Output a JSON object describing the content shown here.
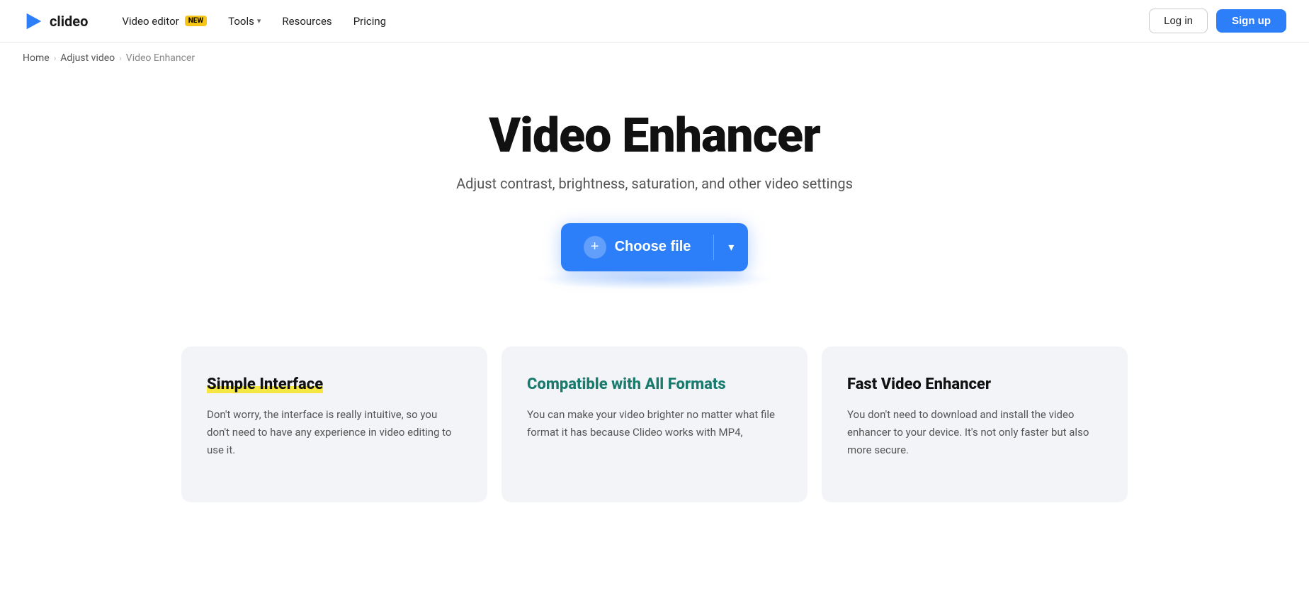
{
  "header": {
    "logo_text": "clideo",
    "nav": [
      {
        "label": "Video editor",
        "badge": "NEW",
        "has_dropdown": false
      },
      {
        "label": "Tools",
        "has_dropdown": true
      },
      {
        "label": "Resources",
        "has_dropdown": false
      },
      {
        "label": "Pricing",
        "has_dropdown": false
      }
    ],
    "login_label": "Log in",
    "signup_label": "Sign up"
  },
  "breadcrumb": {
    "home": "Home",
    "parent": "Adjust video",
    "current": "Video Enhancer"
  },
  "hero": {
    "title": "Video Enhancer",
    "subtitle": "Adjust contrast, brightness, saturation, and other video settings",
    "choose_file_label": "Choose file"
  },
  "features": [
    {
      "id": "simple-interface",
      "title": "Simple Interface",
      "title_style": "highlight",
      "description": "Don't worry, the interface is really intuitive, so you don't need to have any experience in video editing to use it."
    },
    {
      "id": "compatible-formats",
      "title": "Compatible with All Formats",
      "title_style": "teal",
      "description": "You can make your video brighter no matter what file format it has because Clideo works with MP4,"
    },
    {
      "id": "fast-enhancer",
      "title": "Fast Video Enhancer",
      "title_style": "dark",
      "description": "You don't need to download and install the video enhancer to your device. It's not only faster but also more secure."
    }
  ]
}
